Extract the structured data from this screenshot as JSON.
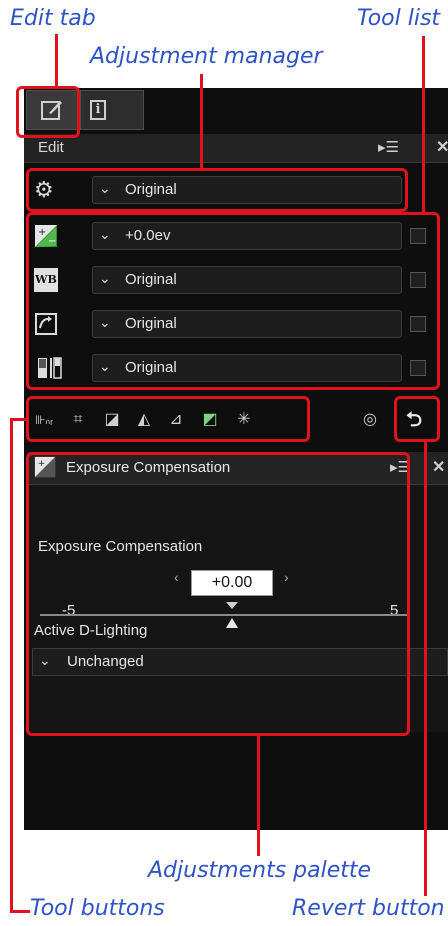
{
  "callouts": {
    "edit_tab": "Edit tab",
    "tool_list": "Tool list",
    "adjustment_manager": "Adjustment manager",
    "adjustments_palette": "Adjustments palette",
    "tool_buttons": "Tool buttons",
    "revert_button": "Revert button"
  },
  "panel": {
    "header_title": "Edit",
    "adjustment_manager_value": "Original",
    "tools": [
      {
        "icon": "exposure-icon",
        "value": "+0.0ev"
      },
      {
        "icon": "white-balance-icon",
        "value": "Original",
        "icon_text": "WB"
      },
      {
        "icon": "picture-control-icon",
        "value": "Original"
      },
      {
        "icon": "levels-curves-icon",
        "value": "Original"
      }
    ]
  },
  "palette": {
    "title": "Exposure Compensation",
    "section_label": "Exposure Compensation",
    "slider": {
      "min_label": "-5",
      "max_label": "5",
      "value": "+0.00",
      "fraction": 0.5
    },
    "adl_label": "Active D-Lighting",
    "adl_value": "Unchanged"
  },
  "colors": {
    "accent": "#e0121c",
    "callout": "#2e53c6",
    "panel": "#0e0e0e"
  }
}
